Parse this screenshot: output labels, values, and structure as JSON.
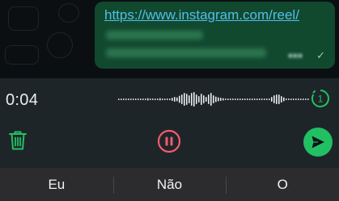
{
  "chat": {
    "message": {
      "link": "https://www.instagram.com/reel/",
      "status_icon": "single-check-icon"
    }
  },
  "recorder": {
    "timer": "0:04",
    "once_label": "1",
    "icons": {
      "delete": "trash-icon",
      "pause": "pause-circle-icon",
      "send": "send-icon",
      "view_once": "view-once-icon"
    },
    "colors": {
      "delete": "#21c063",
      "pause": "#f15c6d",
      "send_bg": "#21c063",
      "view_once": "#21c063"
    }
  },
  "keyboard": {
    "suggestions": [
      "Eu",
      "Não",
      "O"
    ]
  }
}
